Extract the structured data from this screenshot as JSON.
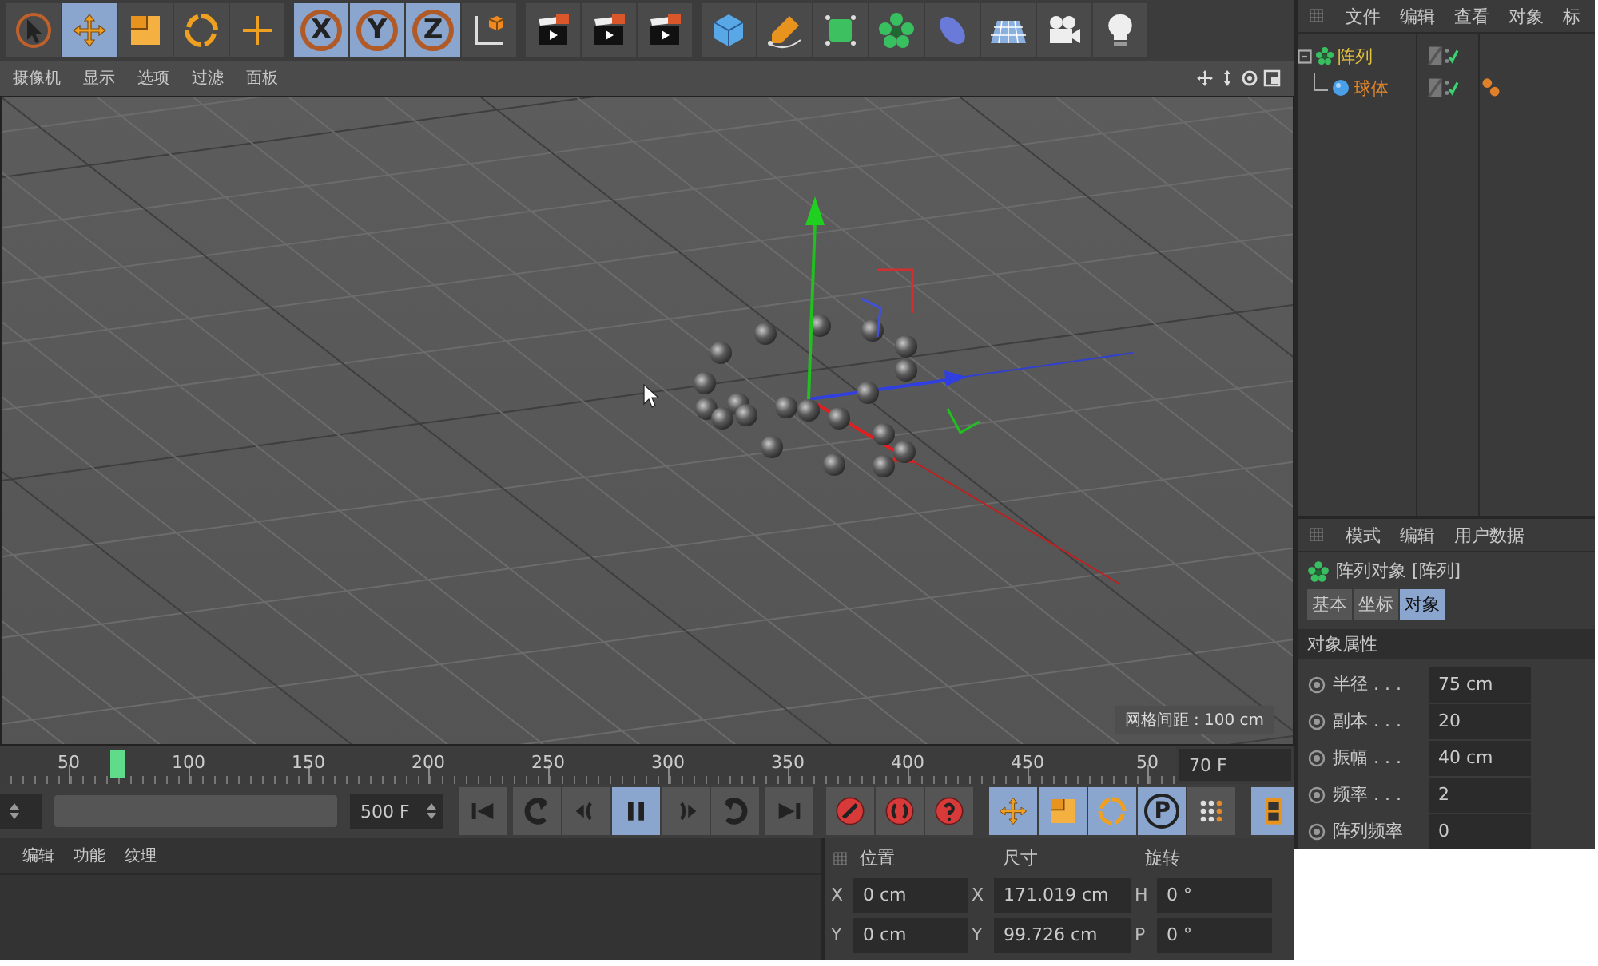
{
  "toolbar": {
    "groups": [
      [
        {
          "kind": "icon",
          "selected": false
        },
        {
          "kind": "icon",
          "selected": true
        },
        {
          "kind": "icon",
          "selected": false
        },
        {
          "kind": "icon",
          "selected": false
        },
        {
          "kind": "icon",
          "selected": false
        }
      ],
      [
        {
          "kind": "axis",
          "label": "X",
          "selected": true
        },
        {
          "kind": "axis",
          "label": "Y",
          "selected": true
        },
        {
          "kind": "axis",
          "label": "Z",
          "selected": true
        },
        {
          "kind": "icon",
          "selected": false
        }
      ],
      [
        {
          "kind": "icon",
          "selected": false
        },
        {
          "kind": "icon",
          "selected": false
        },
        {
          "kind": "icon",
          "selected": false
        }
      ],
      [
        {
          "kind": "icon",
          "selected": false
        },
        {
          "kind": "icon",
          "selected": false
        },
        {
          "kind": "icon",
          "selected": false
        },
        {
          "kind": "icon",
          "selected": false
        },
        {
          "kind": "icon",
          "selected": false
        },
        {
          "kind": "icon",
          "selected": false
        },
        {
          "kind": "icon",
          "selected": false
        },
        {
          "kind": "icon",
          "selected": false
        }
      ]
    ]
  },
  "viewport": {
    "menu": [
      "摄像机",
      "显示",
      "选项",
      "过滤",
      "面板"
    ],
    "grid_spacing": "网格间距 : 100 cm"
  },
  "timeline": {
    "ticks": [
      "50",
      "100",
      "150",
      "200",
      "250",
      "300",
      "350",
      "400",
      "450",
      "50"
    ],
    "playhead": {
      "level": 0.14
    },
    "current_frame": "70 F",
    "end_frame": "500 F"
  },
  "playback": {
    "transport": [
      {
        "kind": "icon",
        "selected": false
      },
      {
        "kind": "icon",
        "selected": false
      },
      {
        "kind": "icon",
        "selected": false
      },
      {
        "kind": "icon",
        "selected": true
      },
      {
        "kind": "icon",
        "selected": false
      },
      {
        "kind": "icon",
        "selected": false
      },
      {
        "kind": "icon",
        "selected": false
      }
    ],
    "record": [
      {
        "kind": "icon",
        "selected": false
      },
      {
        "kind": "icon",
        "selected": false
      },
      {
        "kind": "icon",
        "selected": false
      }
    ],
    "keys": [
      {
        "kind": "icon",
        "selected": true
      },
      {
        "kind": "icon",
        "selected": true
      },
      {
        "kind": "icon",
        "selected": true
      },
      {
        "kind": "letter",
        "label": "P",
        "selected": true
      },
      {
        "kind": "icon",
        "selected": false
      }
    ],
    "layout": {
      "selected": true
    }
  },
  "material_manager": {
    "menu": [
      "编辑",
      "功能",
      "纹理"
    ]
  },
  "coordinates": {
    "headers": [
      "位置",
      "尺寸",
      "旋转"
    ],
    "rows": [
      {
        "cells": [
          {
            "axis": "X",
            "value": "0 cm"
          },
          {
            "axis": "X",
            "value": "171.019 cm"
          },
          {
            "axis": "H",
            "value": "0 °"
          }
        ]
      },
      {
        "cells": [
          {
            "axis": "Y",
            "value": "0 cm"
          },
          {
            "axis": "Y",
            "value": "99.726 cm"
          },
          {
            "axis": "P",
            "value": "0 °"
          }
        ]
      }
    ]
  },
  "object_manager": {
    "menu": [
      "文件",
      "编辑",
      "查看",
      "对象",
      "标"
    ],
    "tree": [
      {
        "name": "阵列",
        "selected": true,
        "children": [
          {
            "name": "球体",
            "selected": true,
            "material": true
          }
        ]
      }
    ]
  },
  "attributes": {
    "menu": [
      "模式",
      "编辑",
      "用户数据"
    ],
    "title": "阵列对象 [阵列]",
    "tabs": [
      {
        "label": "基本",
        "selected": false
      },
      {
        "label": "坐标",
        "selected": false
      },
      {
        "label": "对象",
        "selected": true
      }
    ],
    "section": "对象属性",
    "params": [
      {
        "label": "半径 . . .",
        "value": "75 cm"
      },
      {
        "label": "副本 . . .",
        "value": "20"
      },
      {
        "label": "振幅 . . .",
        "value": "40 cm"
      },
      {
        "label": "频率 . . .",
        "value": "2"
      },
      {
        "label": "阵列频率",
        "value": "0"
      }
    ]
  }
}
